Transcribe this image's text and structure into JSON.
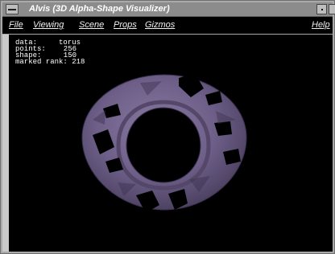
{
  "window": {
    "title": "Alvis (3D Alpha-Shape Visualizer)"
  },
  "menubar": {
    "file": "File",
    "viewing": "Viewing",
    "scene": "Scene",
    "props": "Props",
    "gizmos": "Gizmos",
    "help": "Help"
  },
  "info": {
    "data_label": "data:",
    "data_value": "torus",
    "points_label": "points:",
    "points_value": "256",
    "shape_label": "shape:",
    "shape_value": "150",
    "marked_rank_label": "marked rank:",
    "marked_rank_value": "218"
  },
  "colors": {
    "viewport_bg": "#000000",
    "torus_light": "#7a6a93",
    "torus_mid": "#5f5177",
    "torus_dark": "#3c3150"
  },
  "icons": {
    "system_menu": "window-menu-icon",
    "minimize": "minimize-icon",
    "maximize": "maximize-icon"
  }
}
